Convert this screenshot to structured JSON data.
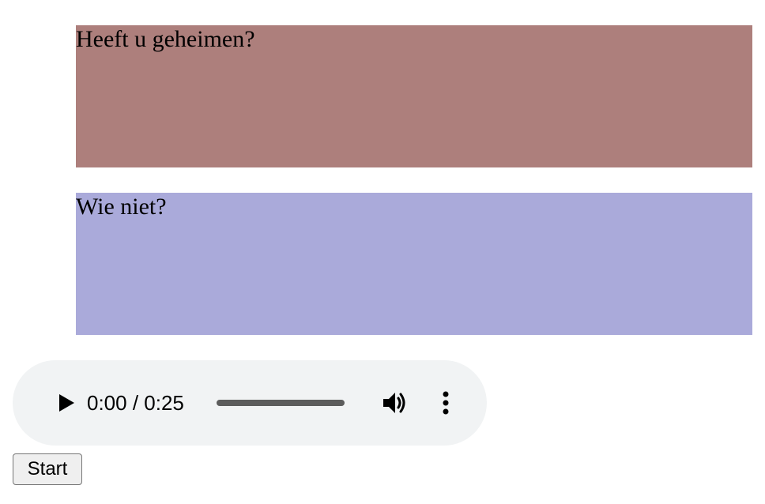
{
  "cues": [
    {
      "text": "Heeft u geheimen?",
      "background": "#ad7f7c"
    },
    {
      "text": "Wie niet?",
      "background": "#aaaada"
    }
  ],
  "audio_player": {
    "current_time": "0:00",
    "duration": "0:25",
    "time_display": "0:00 / 0:25",
    "progress_fraction": 0,
    "play_icon": "play-icon",
    "volume_icon": "volume-icon",
    "more_icon": "more-options-icon",
    "background": "#f1f3f4"
  },
  "start_button": {
    "label": "Start"
  }
}
